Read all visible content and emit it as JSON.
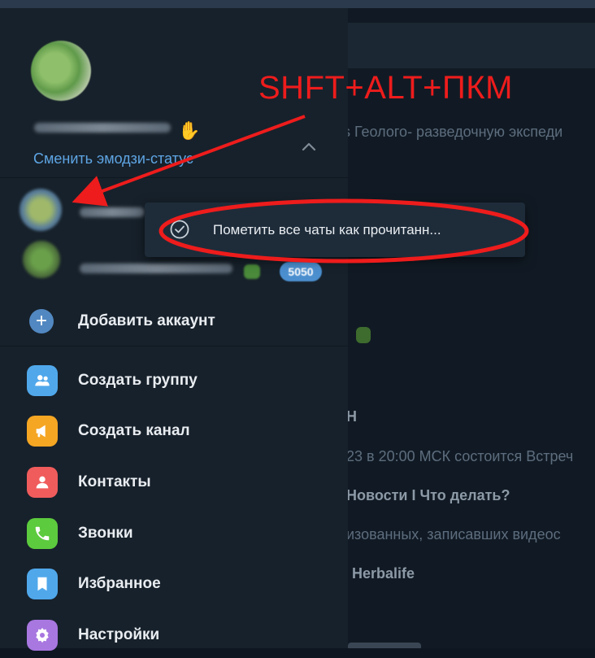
{
  "annotation": {
    "shortcut": "SHFT+ALT+ПКМ",
    "color": "#ee1c1c"
  },
  "background_chat": {
    "snippets": [
      "s Геолого- разведочную экспеди",
      "Н",
      "23 в 20:00 МСК состоится Встреч",
      "Новости I Что делать?",
      "изованных, записавших видеос",
      "Herbalife"
    ]
  },
  "sidebar": {
    "emoji_status_link": "Сменить эмодзи-статус",
    "account_badge": "5050",
    "add_account": "Добавить аккаунт",
    "menu": [
      {
        "label": "Создать группу",
        "icon": "group-icon",
        "color": "#50a8eb"
      },
      {
        "label": "Создать канал",
        "icon": "megaphone-icon",
        "color": "#f5a623"
      },
      {
        "label": "Контакты",
        "icon": "contact-icon",
        "color": "#f05c5c"
      },
      {
        "label": "Звонки",
        "icon": "phone-icon",
        "color": "#5ccb3e"
      },
      {
        "label": "Избранное",
        "icon": "bookmark-icon",
        "color": "#50a8eb"
      },
      {
        "label": "Настройки",
        "icon": "settings-icon",
        "color": "#a877e0"
      }
    ]
  },
  "context_menu": {
    "item_label": "Пометить все чаты как прочитанн..."
  }
}
